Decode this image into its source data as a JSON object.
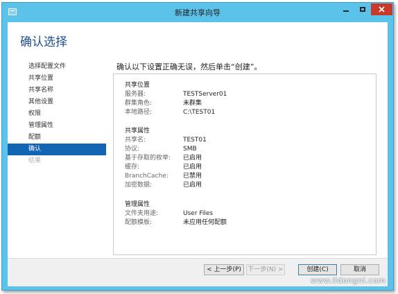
{
  "window": {
    "title": "新建共享向导",
    "page_title": "确认选择"
  },
  "nav": {
    "items": [
      {
        "label": "选择配置文件",
        "state": "normal"
      },
      {
        "label": "共享位置",
        "state": "normal"
      },
      {
        "label": "共享名称",
        "state": "normal"
      },
      {
        "label": "其他设置",
        "state": "normal"
      },
      {
        "label": "权限",
        "state": "normal"
      },
      {
        "label": "管理属性",
        "state": "normal"
      },
      {
        "label": "配额",
        "state": "normal"
      },
      {
        "label": "确认",
        "state": "active"
      },
      {
        "label": "结果",
        "state": "disabled"
      }
    ]
  },
  "main": {
    "instruction": "确认以下设置正确无误，然后单击“创建”。",
    "sections": [
      {
        "title": "共享位置",
        "rows": [
          {
            "key": "服务器:",
            "value": "TESTServer01"
          },
          {
            "key": "群集角色:",
            "value": "未群集"
          },
          {
            "key": "本地路径:",
            "value": "C:\\TEST01"
          }
        ]
      },
      {
        "title": "共享属性",
        "rows": [
          {
            "key": "共享名:",
            "value": "TEST01"
          },
          {
            "key": "协议:",
            "value": "SMB"
          },
          {
            "key": "基于存取的枚举:",
            "value": "已启用"
          },
          {
            "key": "缓存:",
            "value": "已启用"
          },
          {
            "key": "BranchCache:",
            "value": "已禁用"
          },
          {
            "key": "加密数据:",
            "value": "已启用"
          }
        ]
      },
      {
        "title": "管理属性",
        "rows": [
          {
            "key": "文件夹用途:",
            "value": "User Files"
          },
          {
            "key": "配额模板:",
            "value": "未应用任何配额"
          }
        ]
      }
    ]
  },
  "footer": {
    "prev": "< 上一步(P)",
    "next": "下一步(N) >",
    "create": "创建(C)",
    "cancel": "取消"
  },
  "watermark": "www.lidongni.com",
  "colors": {
    "titlebar": "#5bc3ea",
    "accent": "#1464b4",
    "page_title": "#1e4f8f",
    "close_button": "#c83a2a"
  },
  "icons": [
    "app-icon",
    "minimize-icon",
    "maximize-icon",
    "close-icon"
  ]
}
